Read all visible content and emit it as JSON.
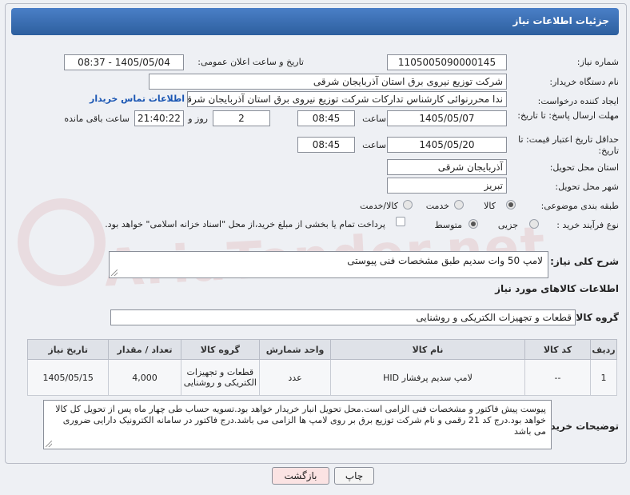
{
  "header": {
    "title": "جزئیات اطلاعات نیاز"
  },
  "form": {
    "need_number_label": "شماره نیاز:",
    "need_number": "1105005090000145",
    "announce_label": "تاریخ و ساعت اعلان عمومی:",
    "announce_value": "1405/05/04 - 08:37",
    "buyer_org_label": "نام دستگاه خریدار:",
    "buyer_org": "شرکت توزیع نیروی برق استان آذربایجان شرقی",
    "requester_label": "ایجاد کننده درخواست:",
    "requester": "ندا محررنوائی کارشناس تدارکات شرکت توزیع نیروی برق استان آذربایجان شرقی",
    "contact_link": "اطلاعات تماس خریدار",
    "deadline_label": "مهلت ارسال پاسخ: تا تاریخ:",
    "deadline_date": "1405/05/07",
    "time_label": "ساعت",
    "deadline_time": "08:45",
    "days_value": "2",
    "days_label": "روز و",
    "remaining_time": "21:40:22",
    "remaining_label": "ساعت باقی مانده",
    "validity_label": "حداقل تاریخ اعتبار قیمت: تا تاریخ:",
    "validity_date": "1405/05/20",
    "validity_time": "08:45",
    "province_label": "استان محل تحویل:",
    "province": "آذربایجان شرقی",
    "city_label": "شهر محل تحویل:",
    "city": "تبریز",
    "category_label": "طبقه بندی موضوعی:",
    "category_options": [
      "کالا",
      "خدمت",
      "کالا/خدمت"
    ],
    "process_label": "نوع فرآیند خرید :",
    "process_options": [
      "جزیی",
      "متوسط"
    ],
    "payment_note": "پرداخت تمام یا بخشی از مبلغ خرید،از محل \"اسناد خزانه اسلامی\" خواهد بود."
  },
  "description": {
    "label": "شرح کلی نیاز:",
    "value": "لامپ 50 وات سدیم طبق مشخصات فنی پیوستی"
  },
  "goods_section": {
    "title": "اطلاعات کالاهای مورد نیاز",
    "group_label": "گروه کالا:",
    "group_value": "قطعات و تجهیزات الکتریکی و روشنایی"
  },
  "table": {
    "headers": [
      "ردیف",
      "کد کالا",
      "نام کالا",
      "واحد شمارش",
      "گروه کالا",
      "تعداد / مقدار",
      "تاریخ نیاز"
    ],
    "rows": [
      {
        "index": "1",
        "code": "--",
        "name": "لامپ سدیم پرفشار HID",
        "unit": "عدد",
        "group": "قطعات و تجهیزات الکتریکی و روشنایی",
        "qty": "4,000",
        "date": "1405/05/15"
      }
    ]
  },
  "buyer_notes": {
    "label": "توضیحات خریدار:",
    "value": "پیوست پیش فاکتور و مشخصات فنی الزامی است.محل تحویل انبار خریدار خواهد بود.تسویه حساب طی چهار ماه پس از تحویل کل کالا خواهد بود.درج کد 21 رقمی و نام شرکت توزیع برق بر روی لامپ ها الزامی می باشد.درج فاکتور در سامانه الکترونیک دارایی ضروری می باشد"
  },
  "buttons": {
    "print": "چاپ",
    "back": "بازگشت"
  },
  "watermark": "AriaTender.net",
  "colors": {
    "header": "#2d5f9e",
    "link": "#1a56b3",
    "back_button": "#fbe3e3"
  }
}
